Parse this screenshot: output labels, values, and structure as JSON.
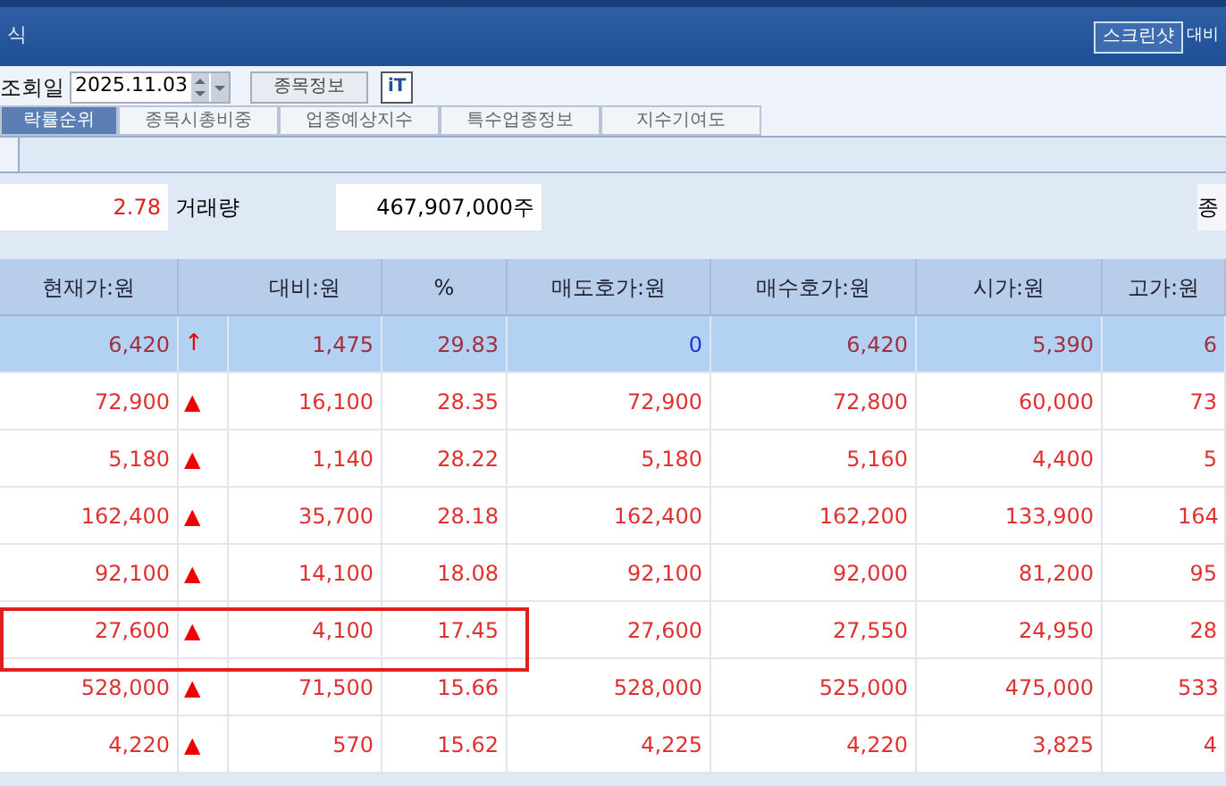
{
  "window": {
    "title": "식",
    "screenshot_button": "스크린샷",
    "title_extra": "대비"
  },
  "toolbar": {
    "date_label": "조회일",
    "date_value": "2025.11.03",
    "info_button": "종목정보",
    "font_button": "iT"
  },
  "tabs": [
    {
      "label": "락률순위",
      "selected": true
    },
    {
      "label": "종목시총비중",
      "selected": false
    },
    {
      "label": "업종예상지수",
      "selected": false
    },
    {
      "label": "특수업종정보",
      "selected": false
    },
    {
      "label": "지수기여도",
      "selected": false
    }
  ],
  "summary": {
    "rate": "2.78",
    "volume_label": "거래량",
    "volume_value": "467,907,000주",
    "column_3": "종"
  },
  "table": {
    "columns": [
      "현재가:원",
      "대비:원",
      "%",
      "매도호가:원",
      "매수호가:원",
      "시가:원",
      "고가:원"
    ],
    "rows": [
      {
        "price": "6,420",
        "sign": "↑",
        "change": "1,475",
        "pct": "29.83",
        "ask": {
          "text": "0",
          "color": "#2233cc"
        },
        "bid": "6,420",
        "open": "5,390",
        "high": "6",
        "selected": true,
        "annotated": false
      },
      {
        "price": "72,900",
        "sign": "▲",
        "change": "16,100",
        "pct": "28.35",
        "ask": {
          "text": "72,900",
          "color": "#e03030"
        },
        "bid": "72,800",
        "open": "60,000",
        "high": "73",
        "selected": false,
        "annotated": false
      },
      {
        "price": "5,180",
        "sign": "▲",
        "change": "1,140",
        "pct": "28.22",
        "ask": {
          "text": "5,180",
          "color": "#e03030"
        },
        "bid": "5,160",
        "open": "4,400",
        "high": "5",
        "selected": false,
        "annotated": false
      },
      {
        "price": "162,400",
        "sign": "▲",
        "change": "35,700",
        "pct": "28.18",
        "ask": {
          "text": "162,400",
          "color": "#e03030"
        },
        "bid": "162,200",
        "open": "133,900",
        "high": "164",
        "selected": false,
        "annotated": false
      },
      {
        "price": "92,100",
        "sign": "▲",
        "change": "14,100",
        "pct": "18.08",
        "ask": {
          "text": "92,100",
          "color": "#e03030"
        },
        "bid": "92,000",
        "open": "81,200",
        "high": "95",
        "selected": false,
        "annotated": false
      },
      {
        "price": "27,600",
        "sign": "▲",
        "change": "4,100",
        "pct": "17.45",
        "ask": {
          "text": "27,600",
          "color": "#e03030"
        },
        "bid": "27,550",
        "open": "24,950",
        "high": "28",
        "selected": false,
        "annotated": true
      },
      {
        "price": "528,000",
        "sign": "▲",
        "change": "71,500",
        "pct": "15.66",
        "ask": {
          "text": "528,000",
          "color": "#e03030"
        },
        "bid": "525,000",
        "open": "475,000",
        "high": "533",
        "selected": false,
        "annotated": false
      },
      {
        "price": "4,220",
        "sign": "▲",
        "change": "570",
        "pct": "15.62",
        "ask": {
          "text": "4,225",
          "color": "#e03030"
        },
        "bid": "4,220",
        "open": "3,825",
        "high": "4",
        "selected": false,
        "annotated": false
      }
    ]
  }
}
